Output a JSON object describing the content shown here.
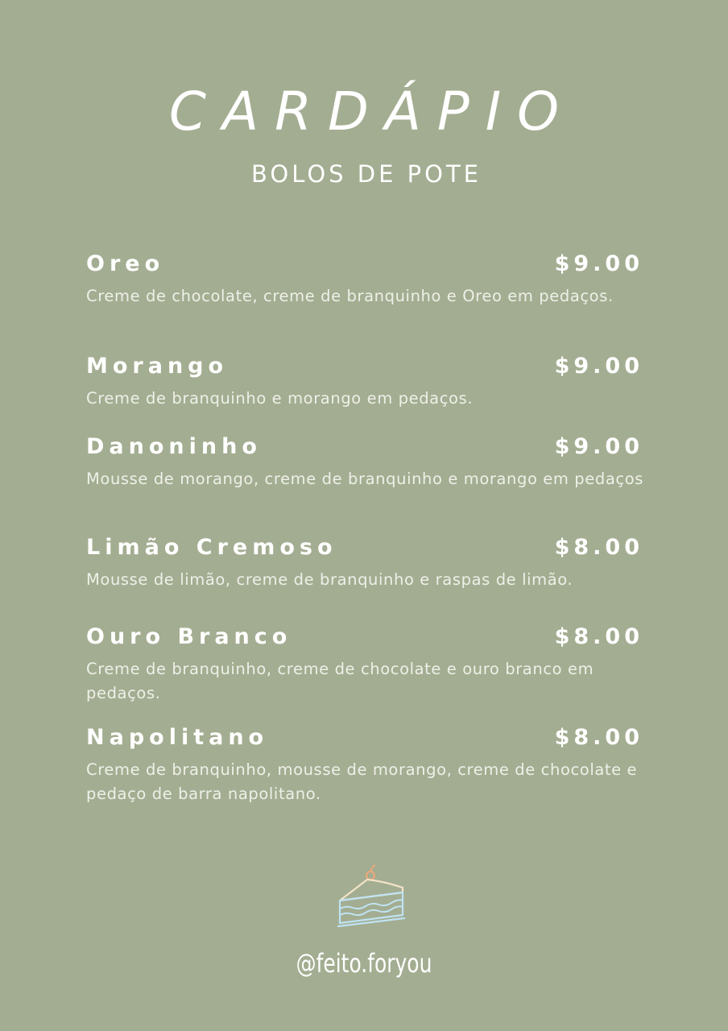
{
  "header": {
    "title": "CARDÁPIO",
    "subtitle": "BOLOS DE POTE"
  },
  "menu": {
    "items": [
      {
        "name": "Oreo",
        "price": "$9.00",
        "description": "Creme de chocolate, creme de branquinho e Oreo em pedaços."
      },
      {
        "name": "Morango",
        "price": "$9.00",
        "description": "Creme de branquinho e morango em pedaços."
      },
      {
        "name": "Danoninho",
        "price": "$9.00",
        "description": "Mousse de morango, creme de branquinho e morango em pedaços"
      },
      {
        "name": "Limão Cremoso",
        "price": "$8.00",
        "description": "Mousse de limão, creme de branquinho e raspas de limão."
      },
      {
        "name": "Ouro Branco",
        "price": "$8.00",
        "description": "Creme de branquinho, creme de chocolate e ouro branco em pedaços."
      },
      {
        "name": "Napolitano",
        "price": "$8.00",
        "description": "Creme de branquinho, mousse de morango, creme de chocolate e pedaço de barra napolitano."
      }
    ]
  },
  "footer": {
    "icon": "cake-slice-icon",
    "handle": "@feito.foryou"
  },
  "colors": {
    "background": "#a3ad91",
    "text": "#ffffff",
    "icon_blue": "#bfe3f2",
    "icon_cream": "#f3e3c8",
    "icon_cherry": "#f0a87a"
  }
}
